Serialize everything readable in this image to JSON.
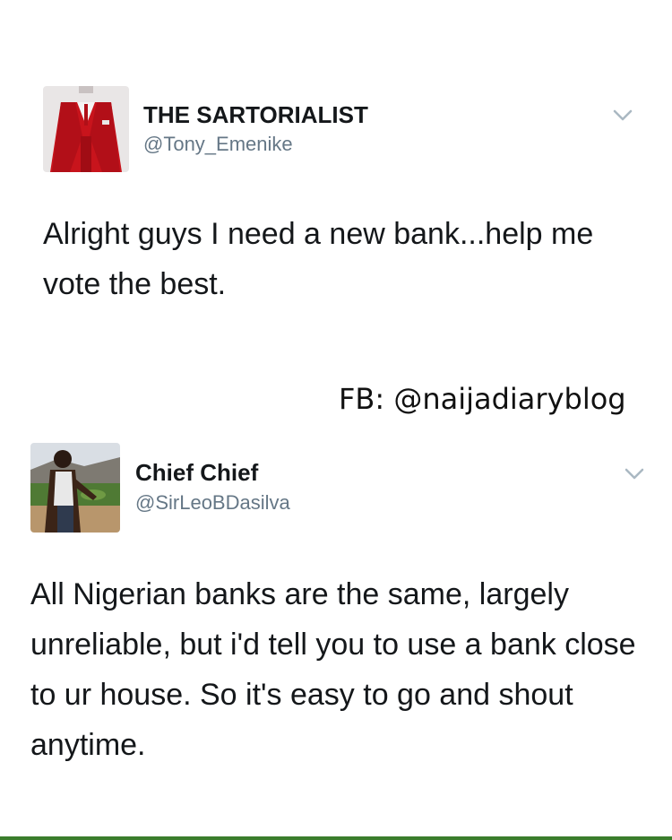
{
  "tweets": [
    {
      "display_name": "THE SARTORIALIST",
      "handle": "@Tony_Emenike",
      "text": "Alright guys I need a new bank...help me vote the best.",
      "avatar_icon": "red-suit-photo"
    },
    {
      "display_name": "Chief Chief",
      "handle": "@SirLeoBDasilva",
      "text": "All Nigerian banks are the same, largely unreliable, but i'd tell you to use a bank close to ur house. So it's easy to go and shout anytime.",
      "avatar_icon": "man-outdoors-photo"
    }
  ],
  "watermark": "FB: @naijadiaryblog",
  "colors": {
    "handle": "#657786",
    "text": "#14171a",
    "chevron": "#aab8c2",
    "bottom_rule": "#3a7d2c"
  },
  "menu_icon": "chevron-down-icon"
}
